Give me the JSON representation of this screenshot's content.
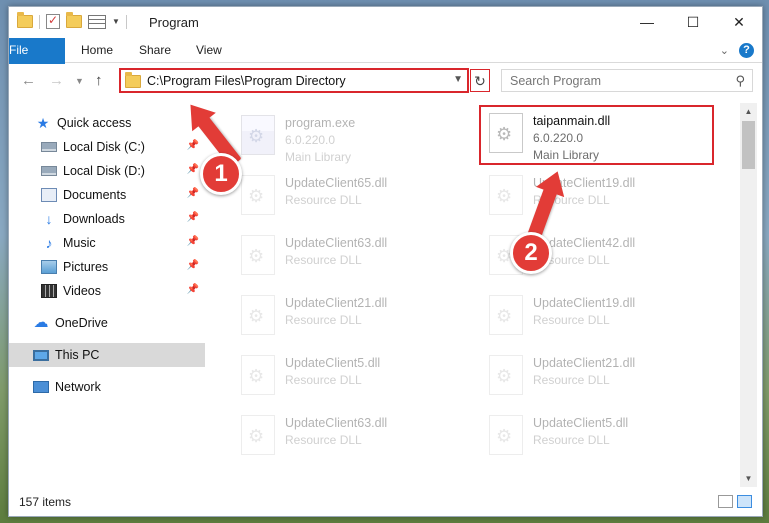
{
  "window": {
    "title": "Program",
    "controls": {
      "minimize": "—",
      "maximize": "☐",
      "close": "✕"
    }
  },
  "ribbon": {
    "tabs": [
      "File",
      "Home",
      "Share",
      "View"
    ],
    "help": "?"
  },
  "address": {
    "path": "C:\\Program Files\\Program Directory",
    "search_placeholder": "Search Program"
  },
  "sidebar": {
    "items": [
      {
        "label": "Quick access",
        "icon": "star-icon",
        "pinned": false
      },
      {
        "label": "Local Disk (C:)",
        "icon": "disk-icon",
        "pinned": true
      },
      {
        "label": "Local Disk (D:)",
        "icon": "disk-icon",
        "pinned": true
      },
      {
        "label": "Documents",
        "icon": "documents-icon",
        "pinned": true
      },
      {
        "label": "Downloads",
        "icon": "download-icon",
        "pinned": true
      },
      {
        "label": "Music",
        "icon": "music-icon",
        "pinned": true
      },
      {
        "label": "Pictures",
        "icon": "pictures-icon",
        "pinned": true
      },
      {
        "label": "Videos",
        "icon": "videos-icon",
        "pinned": true
      },
      {
        "label": "OneDrive",
        "icon": "cloud-icon",
        "pinned": false
      },
      {
        "label": "This PC",
        "icon": "pc-icon",
        "pinned": false,
        "selected": true
      },
      {
        "label": "Network",
        "icon": "network-icon",
        "pinned": false
      }
    ]
  },
  "files": [
    {
      "name": "program.exe",
      "sub1": "6.0.220.0",
      "sub2": "Main Library",
      "faded": true
    },
    {
      "name": "taipanmain.dll",
      "sub1": "6.0.220.0",
      "sub2": "Main Library",
      "faded": false,
      "highlighted": true
    },
    {
      "name": "UpdateClient65.dll",
      "sub1": "Resource DLL",
      "faded": true
    },
    {
      "name": "UpdateClient19.dll",
      "sub1": "Resource DLL",
      "faded": true
    },
    {
      "name": "UpdateClient63.dll",
      "sub1": "Resource DLL",
      "faded": true
    },
    {
      "name": "UpdateClient42.dll",
      "sub1": "Resource DLL",
      "faded": true
    },
    {
      "name": "UpdateClient21.dll",
      "sub1": "Resource DLL",
      "faded": true
    },
    {
      "name": "UpdateClient19.dll",
      "sub1": "Resource DLL",
      "faded": true
    },
    {
      "name": "UpdateClient5.dll",
      "sub1": "Resource DLL",
      "faded": true
    },
    {
      "name": "UpdateClient21.dll",
      "sub1": "Resource DLL",
      "faded": true
    },
    {
      "name": "UpdateClient63.dll",
      "sub1": "Resource DLL",
      "faded": true
    },
    {
      "name": "UpdateClient5.dll",
      "sub1": "Resource DLL",
      "faded": true
    }
  ],
  "status": {
    "items_count": "157 items"
  },
  "annotations": {
    "step1": "1",
    "step2": "2"
  },
  "colors": {
    "accent": "#1979ca",
    "highlight": "#d9262c",
    "annotation": "#e23c37"
  }
}
